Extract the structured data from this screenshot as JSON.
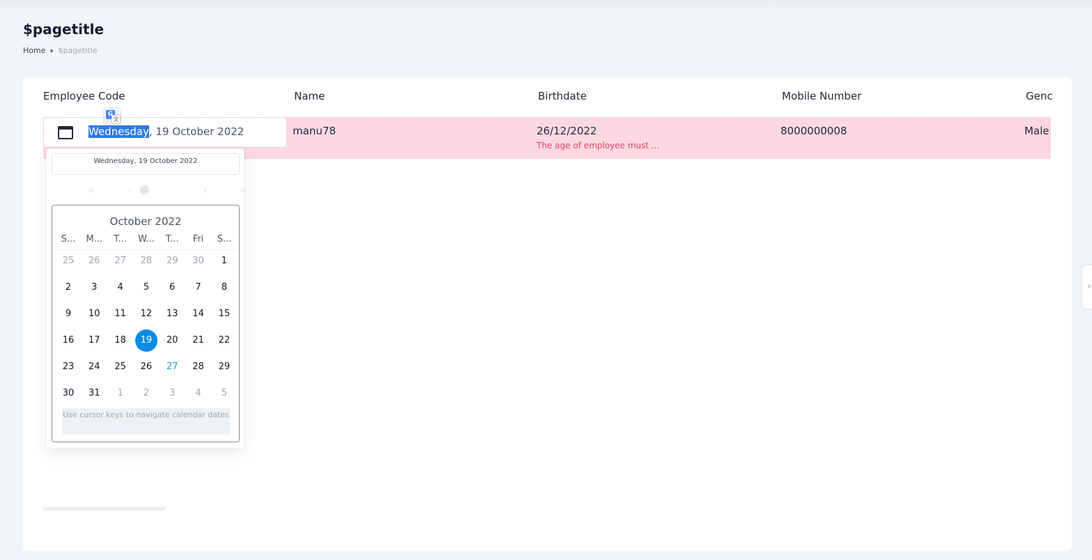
{
  "page": {
    "title": "$pagetitle",
    "breadcrumb": {
      "home": "Home",
      "current": "$pagetitle"
    }
  },
  "table": {
    "columns": [
      "Employee Code",
      "Name",
      "Birthdate",
      "Mobile Number",
      "Genc"
    ],
    "row": {
      "name": "manu78",
      "birthdate": "26/12/2022",
      "birthdate_error": "The age of employee must ...",
      "mobile": "8000000008",
      "gender": "Male"
    }
  },
  "date_input": {
    "selected_part": "Wednesday",
    "rest": ", 19 October 2022"
  },
  "datepicker": {
    "header": "Wednesday, 19 October 2022",
    "nav": {
      "prev_year": "«",
      "prev_month": "‹",
      "next_month": "›",
      "next_year": "»"
    },
    "month_title": "October 2022",
    "weekdays": [
      "S...",
      "M...",
      "T...",
      "W...",
      "T...",
      "Fri",
      "S..."
    ],
    "weeks": [
      [
        "25",
        "26",
        "27",
        "28",
        "29",
        "30",
        "1"
      ],
      [
        "2",
        "3",
        "4",
        "5",
        "6",
        "7",
        "8"
      ],
      [
        "9",
        "10",
        "11",
        "12",
        "13",
        "14",
        "15"
      ],
      [
        "16",
        "17",
        "18",
        "19",
        "20",
        "21",
        "22"
      ],
      [
        "23",
        "24",
        "25",
        "26",
        "27",
        "28",
        "29"
      ],
      [
        "30",
        "31",
        "1",
        "2",
        "3",
        "4",
        "5"
      ]
    ],
    "selected_day": "19",
    "today_day": "27",
    "hint": "Use cursor keys to navigate calendar dates"
  },
  "colors": {
    "row_error_bg": "#fdd8e2",
    "error_text": "#e0426a",
    "selected_day_bg": "#0a8ce6",
    "selection_bg": "#2d7ae6"
  }
}
